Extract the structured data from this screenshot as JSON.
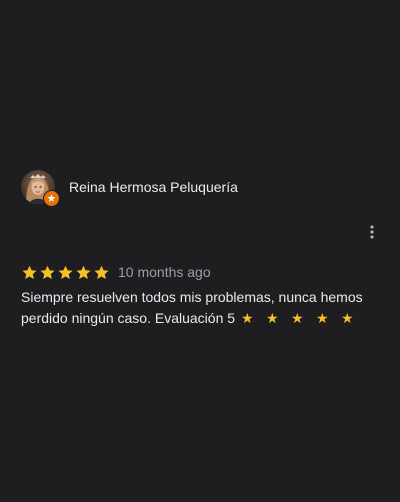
{
  "reviewer": {
    "name": "Reina Hermosa Peluquería",
    "avatar_icon": "profile-photo",
    "badge_icon": "local-guide-badge-icon",
    "badge_color": "#e8710a"
  },
  "menu": {
    "icon": "more-vert-icon"
  },
  "rating": {
    "stars": 5,
    "max": 5,
    "star_color": "#f6c026",
    "time": "10 months ago"
  },
  "review": {
    "text": "Siempre resuelven todos mis problemas, nunca hemos perdido ningún caso. Evaluación 5",
    "inline_stars": "★ ★ ★ ★ ★"
  },
  "colors": {
    "background": "#1e1e20",
    "text": "#e8eaed",
    "secondary_text": "#9aa0a6"
  }
}
